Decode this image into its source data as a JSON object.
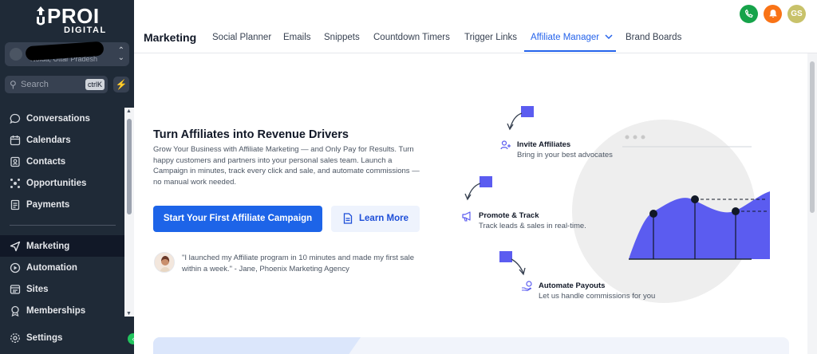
{
  "brand": {
    "name": "PROI",
    "subtitle": "DIGITAL"
  },
  "location": {
    "text": "Noida, Uttar Pradesh"
  },
  "search": {
    "placeholder": "Search",
    "shortcut": "ctrlK"
  },
  "sidebar": {
    "items": [
      {
        "label": "Conversations",
        "icon": "chat-icon"
      },
      {
        "label": "Calendars",
        "icon": "calendar-icon"
      },
      {
        "label": "Contacts",
        "icon": "contacts-icon"
      },
      {
        "label": "Opportunities",
        "icon": "opportunities-icon"
      },
      {
        "label": "Payments",
        "icon": "payments-icon"
      },
      {
        "label": "Marketing",
        "icon": "send-icon",
        "active": true
      },
      {
        "label": "Automation",
        "icon": "automation-icon"
      },
      {
        "label": "Sites",
        "icon": "sites-icon"
      },
      {
        "label": "Memberships",
        "icon": "memberships-icon"
      },
      {
        "label": "Settings",
        "icon": "gear-icon"
      }
    ]
  },
  "header": {
    "title": "Marketing",
    "tabs": [
      {
        "label": "Social Planner"
      },
      {
        "label": "Emails"
      },
      {
        "label": "Snippets"
      },
      {
        "label": "Countdown Timers"
      },
      {
        "label": "Trigger Links"
      },
      {
        "label": "Affiliate Manager",
        "active": true
      },
      {
        "label": "Brand Boards"
      }
    ],
    "user_initials": "GS"
  },
  "hero": {
    "title": "Turn Affiliates into Revenue Drivers",
    "description": "Grow Your Business with Affiliate Marketing — and Only Pay for Results. Turn happy customers and partners into your personal sales team. Launch a Campaign in minutes, track every click and sale, and automate commissions — no manual work needed.",
    "primary_button": "Start Your First Affiliate Campaign",
    "secondary_button": "Learn More",
    "quote": "\"I launched my Affiliate program in 10 minutes and made my first sale within a week.\" - Jane, Phoenix Marketing Agency"
  },
  "features": [
    {
      "title": "Invite Affiliates",
      "desc": "Bring in your best advocates"
    },
    {
      "title": "Promote & Track",
      "desc": "Track leads & sales in real-time."
    },
    {
      "title": "Automate Payouts",
      "desc": "Let us handle commissions for you"
    }
  ],
  "colors": {
    "sidebar_bg": "#1f2a37",
    "accent": "#2563eb",
    "illustration": "#6366f1",
    "phone": "#16a34a",
    "bell": "#f97316",
    "avatar": "#c8c26a"
  }
}
